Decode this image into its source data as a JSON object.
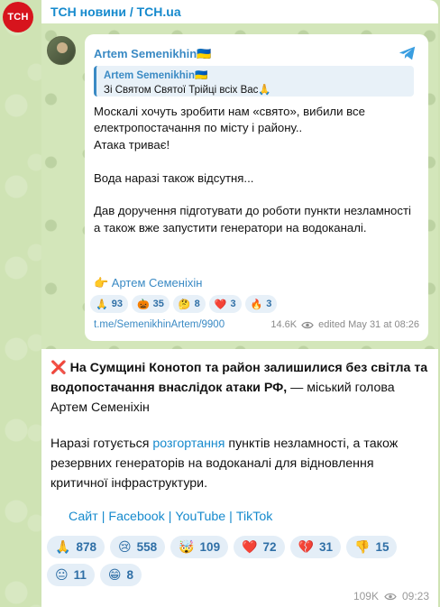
{
  "channel": {
    "name": "ТСН новини / TCH.ua",
    "avatar_text": "TCH"
  },
  "forwarded": {
    "author": "Artem Semenikhin🇺🇦",
    "quote_author": "Artem Semenikhin🇺🇦",
    "quote_text": "Зі Святом Святої Трійці всіх Вас🙏",
    "body": [
      "Москалі хочуть зробити нам «свято», вибили все електропостачання по місту і району..",
      "Атака триває!",
      "",
      "Вода наразі також відсутня...",
      "Дав доручення підготувати до роботи пункти незламності а також вже запустити генератори на водоканалі."
    ],
    "signature": "👉 Артем Семеніхін",
    "reactions": [
      {
        "emoji": "🙏",
        "count": "93"
      },
      {
        "emoji": "🎃",
        "count": "35"
      },
      {
        "emoji": "🤔",
        "count": "8"
      },
      {
        "emoji": "❤️",
        "count": "3"
      },
      {
        "emoji": "🔥",
        "count": "3"
      }
    ],
    "link": "t.me/SemenikhinArtem/9900",
    "views": "14.6K",
    "edited": "edited May 31 at 08:26"
  },
  "message": {
    "headline_bold": "На Сумщині Конотоп та район залишилися без світла та водопостачання внаслідок атаки РФ,",
    "headline_rest": " — міський голова Артем Семеніхін",
    "p2_before": "Наразі готується ",
    "p2_link": "розгортання",
    "p2_after": " пунктів незламності, а також резервних генераторів на водоканалі для відновлення критичної інфраструктури.",
    "links": [
      "Сайт",
      "Facebook",
      "YouTube",
      "TikTok"
    ]
  },
  "reactions": [
    {
      "emoji": "🙏",
      "count": "878"
    },
    {
      "emoji": "😢",
      "count": "558"
    },
    {
      "emoji": "🤯",
      "count": "109"
    },
    {
      "emoji": "❤️",
      "count": "72"
    },
    {
      "emoji": "💔",
      "count": "31"
    },
    {
      "emoji": "👎",
      "count": "15"
    },
    {
      "emoji": "😐",
      "count": "11"
    },
    {
      "emoji": "😁",
      "count": "8"
    }
  ],
  "meta": {
    "views": "109K",
    "time": "09:23"
  }
}
